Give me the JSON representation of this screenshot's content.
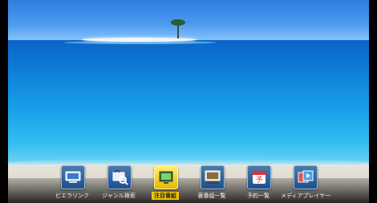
{
  "menu": {
    "items": [
      {
        "label": "ビエラリンク",
        "icon": "viera-link-icon",
        "selected": false
      },
      {
        "label": "ジャンル検索",
        "icon": "genre-search-icon",
        "selected": false
      },
      {
        "label": "注目番組",
        "icon": "featured-programs-icon",
        "selected": true
      },
      {
        "label": "裏番組一覧",
        "icon": "other-channel-list-icon",
        "selected": false
      },
      {
        "label": "予約一覧",
        "icon": "reservation-list-icon",
        "selected": false
      },
      {
        "label": "メディアプレイヤー",
        "icon": "media-player-icon",
        "selected": false
      }
    ]
  },
  "colors": {
    "highlight": "#f1c400",
    "label_text": "#f0f0f0"
  }
}
